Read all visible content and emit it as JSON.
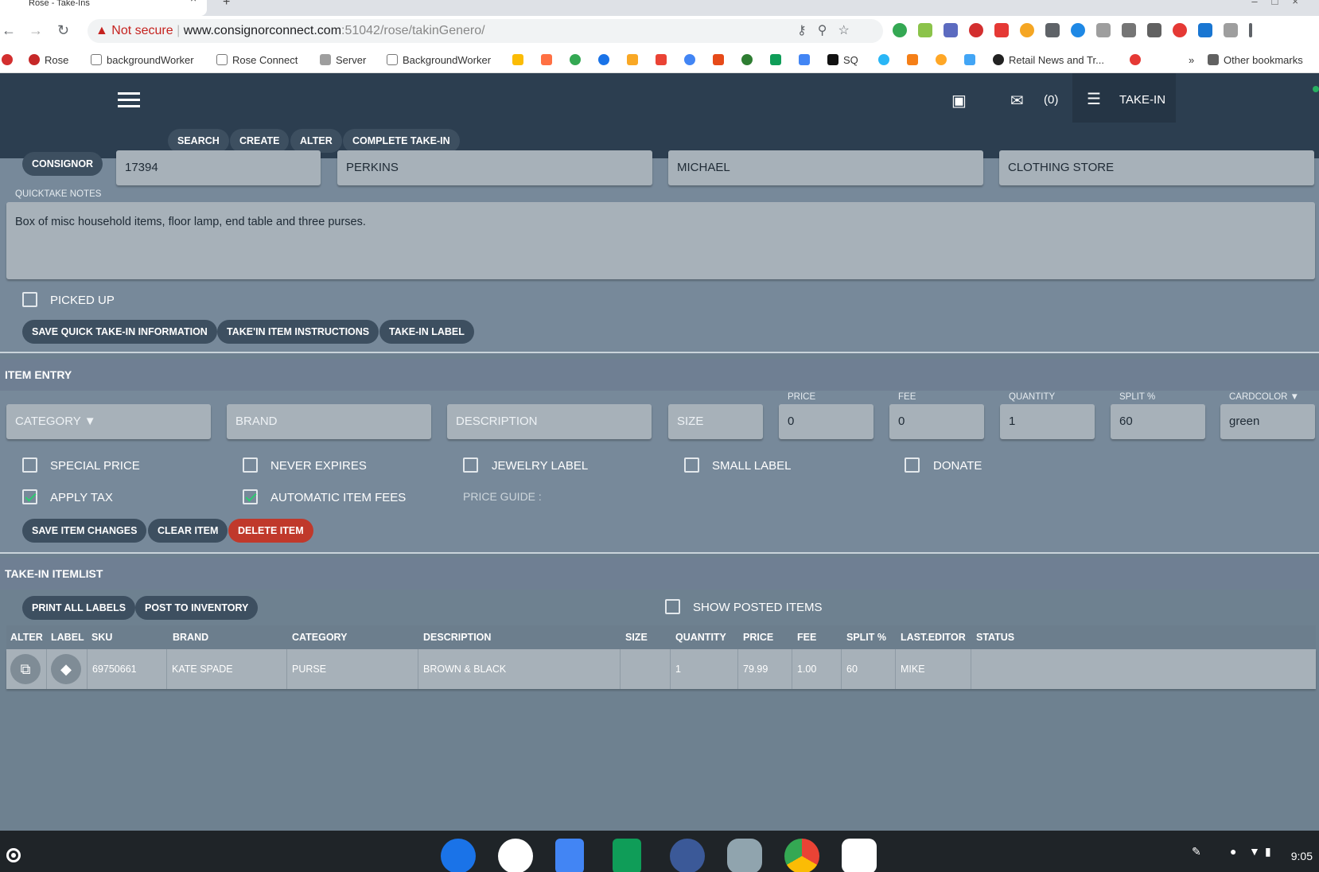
{
  "browser": {
    "tab_title": "Rose - Take-Ins",
    "security_label": "Not secure",
    "url_host": "www.consignorconnect.com",
    "url_path": ":51042/rose/takinGenero/",
    "bookmarks": [
      "Rose",
      "backgroundWorker",
      "Rose Connect",
      "Server",
      "BackgroundWorker",
      "SQ",
      "Retail News and Tr...",
      "Other bookmarks"
    ],
    "bookmarks_more": "»"
  },
  "header": {
    "message_count": "(0)",
    "active_module": "TAKE-IN",
    "nav_buttons": [
      "SEARCH",
      "CREATE",
      "ALTER",
      "COMPLETE TAKE-IN"
    ]
  },
  "consignor": {
    "label": "CONSIGNOR",
    "id": "17394",
    "last_name": "PERKINS",
    "first_name": "MICHAEL",
    "company": "CLOTHING STORE",
    "notes_label": "QUICKTAKE NOTES",
    "notes": "Box of misc household items, floor lamp, end table and three purses.",
    "picked_up_label": "PICKED UP",
    "picked_up": false,
    "buttons": [
      "SAVE QUICK TAKE-IN INFORMATION",
      "TAKE'IN ITEM INSTRUCTIONS",
      "TAKE-IN LABEL"
    ]
  },
  "item_entry": {
    "title": "ITEM ENTRY",
    "category_placeholder": "CATEGORY ▼",
    "brand_placeholder": "BRAND",
    "description_placeholder": "DESCRIPTION",
    "size_placeholder": "SIZE",
    "price_label": "PRICE",
    "price": "0",
    "fee_label": "FEE",
    "fee": "0",
    "quantity_label": "QUANTITY",
    "quantity": "1",
    "split_label": "SPLIT %",
    "split": "60",
    "cardcolor_label": "CARDCOLOR ▼",
    "cardcolor": "green",
    "checkboxes": [
      {
        "label": "SPECIAL PRICE",
        "checked": false
      },
      {
        "label": "NEVER EXPIRES",
        "checked": false
      },
      {
        "label": "JEWELRY LABEL",
        "checked": false
      },
      {
        "label": "SMALL LABEL",
        "checked": false
      },
      {
        "label": "DONATE",
        "checked": false
      },
      {
        "label": "APPLY TAX",
        "checked": true
      },
      {
        "label": "AUTOMATIC ITEM FEES",
        "checked": true
      }
    ],
    "price_guide_label": "PRICE GUIDE :",
    "buttons": [
      "SAVE ITEM CHANGES",
      "CLEAR ITEM",
      "DELETE ITEM"
    ]
  },
  "itemlist": {
    "title": "TAKE-IN ITEMLIST",
    "buttons": [
      "PRINT ALL LABELS",
      "POST TO INVENTORY"
    ],
    "show_posted_label": "SHOW POSTED ITEMS",
    "show_posted": false,
    "columns": [
      "ALTER",
      "LABEL",
      "SKU",
      "BRAND",
      "CATEGORY",
      "DESCRIPTION",
      "SIZE",
      "QUANTITY",
      "PRICE",
      "FEE",
      "SPLIT %",
      "LAST.EDITOR",
      "STATUS"
    ],
    "rows": [
      {
        "sku": "69750661",
        "brand": "KATE SPADE",
        "category": "PURSE",
        "description": "BROWN & BLACK",
        "size": "",
        "quantity": "1",
        "price": "79.99",
        "fee": "1.00",
        "split": "60",
        "last_editor": "MIKE",
        "status": ""
      }
    ]
  },
  "shelf": {
    "clock": "9:05",
    "apps": [
      "messages-app",
      "play-store-app",
      "docs-app",
      "sheets-app",
      "facebook-app",
      "sftp-client-app",
      "chrome-app",
      "square-app"
    ]
  },
  "colors": {
    "header_bg": "#2c3e50",
    "content_bg": "#6e8190",
    "delete_red": "#c0392b",
    "check_green": "#2ecc71"
  }
}
